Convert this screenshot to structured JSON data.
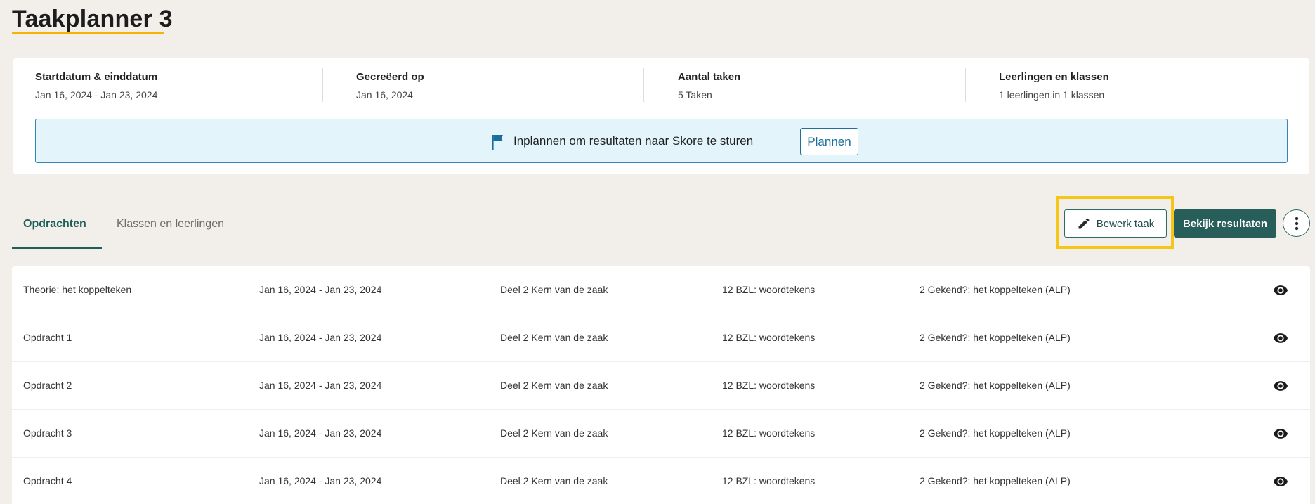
{
  "page": {
    "title": "Taakplanner 3"
  },
  "summary": {
    "items": [
      {
        "label": "Startdatum & einddatum",
        "value": "Jan 16, 2024 - Jan 23, 2024"
      },
      {
        "label": "Gecreëerd op",
        "value": "Jan 16, 2024"
      },
      {
        "label": "Aantal taken",
        "value": "5 Taken"
      },
      {
        "label": "Leerlingen en klassen",
        "value": "1 leerlingen in 1 klassen"
      }
    ]
  },
  "banner": {
    "text": "Inplannen om resultaten naar Skore te sturen",
    "button_label": "Plannen",
    "icon": "flag-icon"
  },
  "tabs": [
    {
      "label": "Opdrachten",
      "active": true
    },
    {
      "label": "Klassen en leerlingen",
      "active": false
    }
  ],
  "actions": {
    "edit_label": "Bewerk taak",
    "results_label": "Bekijk resultaten",
    "highlight_color": "#f5c518"
  },
  "tasks": [
    {
      "name": "Theorie: het koppelteken",
      "dates": "Jan 16, 2024 - Jan 23, 2024",
      "book": "Deel 2 Kern van de zaak",
      "chapter": "12 BZL: woordtekens",
      "lesson": "2 Gekend?: het koppelteken (ALP)"
    },
    {
      "name": "Opdracht 1",
      "dates": "Jan 16, 2024 - Jan 23, 2024",
      "book": "Deel 2 Kern van de zaak",
      "chapter": "12 BZL: woordtekens",
      "lesson": "2 Gekend?: het koppelteken (ALP)"
    },
    {
      "name": "Opdracht 2",
      "dates": "Jan 16, 2024 - Jan 23, 2024",
      "book": "Deel 2 Kern van de zaak",
      "chapter": "12 BZL: woordtekens",
      "lesson": "2 Gekend?: het koppelteken (ALP)"
    },
    {
      "name": "Opdracht 3",
      "dates": "Jan 16, 2024 - Jan 23, 2024",
      "book": "Deel 2 Kern van de zaak",
      "chapter": "12 BZL: woordtekens",
      "lesson": "2 Gekend?: het koppelteken (ALP)"
    },
    {
      "name": "Opdracht 4",
      "dates": "Jan 16, 2024 - Jan 23, 2024",
      "book": "Deel 2 Kern van de zaak",
      "chapter": "12 BZL: woordtekens",
      "lesson": "2 Gekend?: het koppelteken (ALP)"
    }
  ],
  "colors": {
    "background": "#f2efea",
    "accent": "#275e5a",
    "title_underline": "#f4b400",
    "banner_bg": "#e3f4fb",
    "banner_border": "#2f86b8"
  }
}
